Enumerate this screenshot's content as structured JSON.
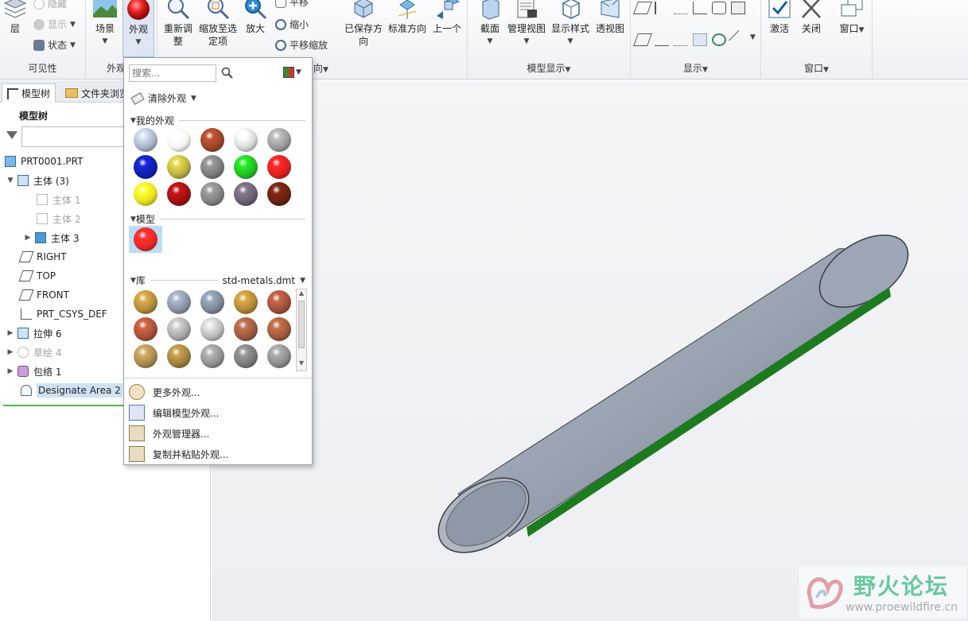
{
  "ribbon": {
    "visibility": {
      "label": "可见性",
      "layer": "层",
      "hide": "隐藏",
      "show": "显示",
      "status": "状态"
    },
    "appearance": {
      "label_partial": "外观",
      "scene": "场景",
      "appearance": "外观"
    },
    "orientation": {
      "refit": "重新调\n整",
      "zoom_selected": "缩放至选\n定项",
      "zoom_in": "放大",
      "pan": "平移",
      "zoom_out": "缩小",
      "pan_zoom": "平移缩放",
      "saved_views": "已保存方\n向",
      "standard_orientation": "标准方向",
      "previous": "上一个",
      "label_partial": "向"
    },
    "model_display": {
      "label": "模型显示",
      "section": "截面",
      "manage_views": "管理视图",
      "display_style": "显示样式",
      "perspective": "透视图"
    },
    "display": {
      "label": "显示"
    },
    "window": {
      "label": "窗口",
      "activate": "激活",
      "close": "关闭",
      "windows": "窗口"
    }
  },
  "tree": {
    "tabs": [
      "模型树",
      "文件夹浏览"
    ],
    "header": "模型树",
    "items": [
      {
        "label": "PRT0001.PRT"
      },
      {
        "label": "主体 (3)"
      },
      {
        "label": "主体 1"
      },
      {
        "label": "主体 2"
      },
      {
        "label": "主体 3"
      },
      {
        "label": "RIGHT"
      },
      {
        "label": "TOP"
      },
      {
        "label": "FRONT"
      },
      {
        "label": "PRT_CSYS_DEF"
      },
      {
        "label": "拉伸 6"
      },
      {
        "label": "草绘 4"
      },
      {
        "label": "包络 1"
      },
      {
        "label": "Designate Area 2"
      }
    ]
  },
  "dropdown": {
    "search_placeholder": "搜索...",
    "clear_appearance": "清除外观",
    "my_appearances": "我的外观",
    "model": "模型",
    "library": "库",
    "library_file": "std-metals.dmt",
    "my_colors": [
      "#a8b4c4",
      "#f4f4ee",
      "#9a4428",
      "#d8d8d8",
      "#9a9a9a",
      "#1020b0",
      "#b8b040",
      "#7a7a7a",
      "#20c020",
      "#e02020",
      "#e8e020",
      "#a01010",
      "#808080",
      "#6a6070",
      "#6a2010"
    ],
    "model_colors": [
      "#e82828"
    ],
    "library_colors": [
      "#b08a3a",
      "#8894a4",
      "#7c8898",
      "#b08838",
      "#a0503a",
      "#a85038",
      "#a8a8a8",
      "#b8b8b8",
      "#9c5a40",
      "#a05a3c",
      "#a88a50",
      "#a08040",
      "#909090",
      "#7a7a7a",
      "#8c8c8c"
    ],
    "menu": [
      "更多外观...",
      "编辑模型外观...",
      "外观管理器...",
      "复制并粘贴外观..."
    ]
  },
  "watermark": {
    "title": "野火论坛",
    "url": "www.proewildfire.cn"
  },
  "colors": {
    "pipe": "#9aa4b2",
    "stripe": "#1e7a1e",
    "accent": "#3b82c4"
  }
}
